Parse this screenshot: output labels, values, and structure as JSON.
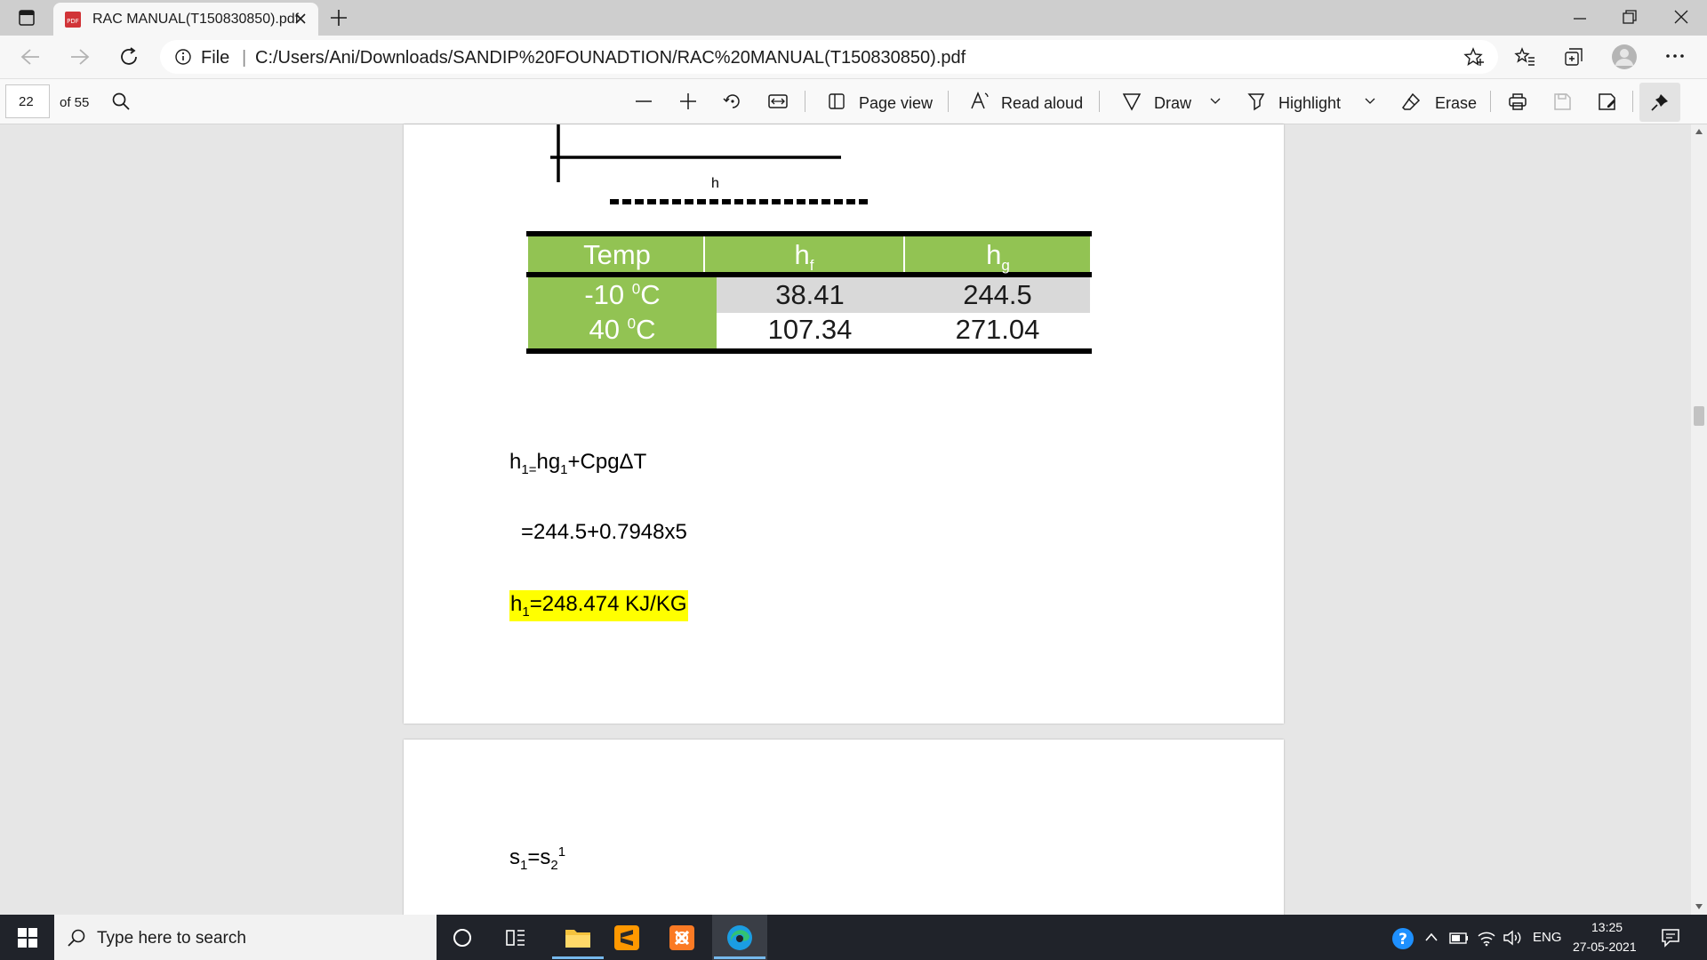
{
  "browser": {
    "tab_title": "RAC MANUAL(T150830850).pdf",
    "address_label": "File",
    "url": "C:/Users/Ani/Downloads/SANDIP%20FOUNADTION/RAC%20MANUAL(T150830850).pdf"
  },
  "pdf_toolbar": {
    "page_number": "22",
    "page_total": "of 55",
    "page_view_label": "Page view",
    "read_aloud_label": "Read aloud",
    "draw_label": "Draw",
    "highlight_label": "Highlight",
    "erase_label": "Erase"
  },
  "document": {
    "diagram_label": "h",
    "table": {
      "headers": [
        "Temp",
        "hf",
        "hg"
      ],
      "rows": [
        [
          "-10 0C",
          "38.41",
          "244.5"
        ],
        [
          "40 0C",
          "107.34",
          "271.04"
        ]
      ]
    },
    "formula1": "h1=hg1+CpgΔT",
    "formula2": "=244.5+0.7948x5",
    "formula3": "h1=248.474 KJ/KG",
    "formula4": "s1=s21"
  },
  "taskbar": {
    "search_placeholder": "Type here to search",
    "language": "ENG",
    "time": "13:25",
    "date": "27-05-2021"
  },
  "colors": {
    "table_green": "#92c353",
    "highlight_yellow": "#ffff00",
    "taskbar_bg": "#20232a"
  }
}
